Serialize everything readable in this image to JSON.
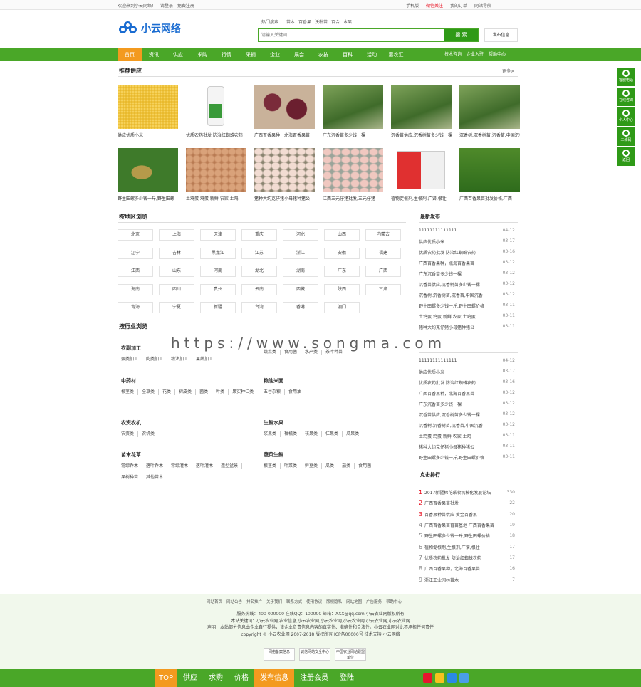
{
  "topbar": {
    "left": [
      "欢迎来到小云网络！",
      "请登录",
      "免费注册"
    ],
    "right": [
      "手机版",
      "微信关注",
      "我的订单",
      "网站导航"
    ]
  },
  "header": {
    "logo_text": "小云网络",
    "hot_label": "热门搜索：",
    "hot_words": [
      "苗木",
      "百香果",
      "沃柑苗",
      "百合",
      "水果"
    ],
    "search_placeholder": "请输入关键词",
    "search_button": "搜 索",
    "publish_button": "发布信息"
  },
  "nav": {
    "items": [
      "首页",
      "资讯",
      "供应",
      "求购",
      "行情",
      "采摘",
      "企业",
      "展会",
      "农技",
      "百科",
      "活动",
      "惠农汇"
    ],
    "right": [
      "技术咨询",
      "企业入驻",
      "帮助中心"
    ]
  },
  "supply": {
    "title": "推荐供应",
    "more": "更多>",
    "products": [
      {
        "caption": "供应优质小米",
        "kind": "millet"
      },
      {
        "caption": "优质农药批发 防治红蜘蛛农药",
        "kind": "bottle"
      },
      {
        "caption": "广西百香果种，北海百香果苗",
        "kind": "passion"
      },
      {
        "caption": "广东沉香苗多少钱一棵",
        "kind": "seedling"
      },
      {
        "caption": "沉香苗供应,沉香树苗多少钱一棵",
        "kind": "seedling"
      },
      {
        "caption": "沉香树,沉香树苗,沉香苗,中国沉香",
        "kind": "seedling"
      },
      {
        "caption": "野生田螺多少钱一斤,野生田螺",
        "kind": "snail"
      },
      {
        "caption": "土鸡蛋 鸡蛋 新鲜 农家 土鸡",
        "kind": "eggs"
      },
      {
        "caption": "猪种大约克仔猪小母猪种猪公",
        "kind": "pigs"
      },
      {
        "caption": "江西三元仔猪批发,三元仔猪",
        "kind": "piglets"
      },
      {
        "caption": "植物促根剂,生根剂,广谱,根壮",
        "kind": "box"
      },
      {
        "caption": "广西百香果苗批发价格,广西",
        "kind": "seedling2"
      }
    ]
  },
  "regions": {
    "title": "按地区浏览",
    "items": [
      "北京",
      "上海",
      "天津",
      "重庆",
      "河北",
      "山西",
      "内蒙古",
      "辽宁",
      "吉林",
      "黑龙江",
      "江苏",
      "浙江",
      "安徽",
      "福建",
      "江西",
      "山东",
      "河南",
      "湖北",
      "湖南",
      "广东",
      "广西",
      "海南",
      "四川",
      "贵州",
      "云南",
      "西藏",
      "陕西",
      "甘肃",
      "青海",
      "宁夏",
      "新疆",
      "台湾",
      "香港",
      "澳门"
    ]
  },
  "latest": {
    "title": "最新发布",
    "items": [
      {
        "t": "11111111111111",
        "d": "04-12"
      },
      {
        "t": "供应优质小米",
        "d": "03-17"
      },
      {
        "t": "优质农药批发 防治红蜘蛛农药",
        "d": "03-16"
      },
      {
        "t": "广西百香果种，北海百香果苗",
        "d": "03-12"
      },
      {
        "t": "广东沉香苗多少钱一棵",
        "d": "03-12"
      },
      {
        "t": "沉香苗供应,沉香树苗多少钱一棵",
        "d": "03-12"
      },
      {
        "t": "沉香树,沉香树苗,沉香苗,中国沉香",
        "d": "03-12"
      },
      {
        "t": "野生田螺多少钱一斤,野生田螺价格",
        "d": "03-11"
      },
      {
        "t": "土鸡蛋 鸡蛋 新鲜 农家 土鸡蛋",
        "d": "03-11"
      },
      {
        "t": "猪种大约克仔猪小母猪种猪公",
        "d": "03-11"
      }
    ]
  },
  "industry": {
    "title": "按行业浏览",
    "groups": [
      {
        "name": "农副加工",
        "tags": [
          "蛋类加工",
          "肉类加工",
          "粮油加工",
          "果蔬加工"
        ]
      },
      {
        "name": "",
        "tags": [
          "蔬菜类",
          "食用菌",
          "水产类",
          "茶叶种苗"
        ]
      },
      {
        "name": "中药材",
        "tags": [
          "根茎类",
          "全草类",
          "花类",
          "树皮类",
          "菌类",
          "叶类",
          "果实种仁类"
        ]
      },
      {
        "name": "粮油米面",
        "tags": [
          "五谷杂粮",
          "食用油"
        ]
      },
      {
        "name": "农资农机",
        "tags": [
          "农资类",
          "农机类"
        ]
      },
      {
        "name": "生鲜水果",
        "tags": [
          "浆果类",
          "柑橘类",
          "核果类",
          "仁果类",
          "瓜果类"
        ]
      },
      {
        "name": "苗木花草",
        "tags": [
          "常绿乔木",
          "落叶乔木",
          "常绿灌木",
          "落叶灌木",
          "造型盆景",
          "果树种苗",
          "其他苗木"
        ]
      },
      {
        "name": "蔬菜生鲜",
        "tags": [
          "根茎类",
          "叶菜类",
          "鲜豆类",
          "瓜类",
          "茄类",
          "食用菌"
        ]
      }
    ]
  },
  "latest2": {
    "items": [
      {
        "t": "11111111111111",
        "d": "04-12"
      },
      {
        "t": "供应优质小米",
        "d": "03-17"
      },
      {
        "t": "优质农药批发 防治红蜘蛛农药",
        "d": "03-16"
      },
      {
        "t": "广西百香果种，北海百香果苗",
        "d": "03-12"
      },
      {
        "t": "广东沉香苗多少钱一棵",
        "d": "03-12"
      },
      {
        "t": "沉香苗供应,沉香树苗多少钱一棵",
        "d": "03-12"
      },
      {
        "t": "沉香树,沉香树苗,沉香苗,中国沉香",
        "d": "03-12"
      },
      {
        "t": "土鸡蛋 鸡蛋 新鲜 农家 土鸡",
        "d": "03-11"
      },
      {
        "t": "猪种大约克仔猪小母猪种猪公",
        "d": "03-11"
      },
      {
        "t": "野生田螺多少钱一斤,野生田螺价格",
        "d": "03-11"
      }
    ]
  },
  "ranking": {
    "title": "点击排行",
    "items": [
      {
        "n": "1",
        "t": "2017新疆棉花采收机械化发展论坛",
        "c": "330"
      },
      {
        "n": "2",
        "t": "广西百香果苗批发",
        "c": "22"
      },
      {
        "n": "3",
        "t": "百香果种苗供应 黄金百香果",
        "c": "20"
      },
      {
        "n": "4",
        "t": "广西百香果苗育苗基地 广西百香果苗",
        "c": "19"
      },
      {
        "n": "5",
        "t": "野生田螺多少钱一斤,野生田螺价格",
        "c": "18"
      },
      {
        "n": "6",
        "t": "植物促根剂,生根剂,广谱,根壮",
        "c": "17"
      },
      {
        "n": "7",
        "t": "优质农药批发 防治红蜘蛛农药",
        "c": "17"
      },
      {
        "n": "8",
        "t": "广西百香果种，北海百香果苗",
        "c": "16"
      },
      {
        "n": "9",
        "t": "浙江工业园林苗木",
        "c": "7"
      }
    ]
  },
  "footer": {
    "links": [
      "网站首页",
      "网站公告",
      "排名推广",
      "关于我们",
      "联系方式",
      "使用协议",
      "版权隐私",
      "网站地图",
      "广告服务",
      "帮助中心"
    ],
    "lines": [
      "服务热线：400-000000 在线QQ：100000 邮箱：XXX@qq.com 小云农业网版权所有",
      "本站关键词：小云农业网,农业信息,小云农业网,小云农业网,小云农业网,小云农业网,小云农业网",
      "声明：本站部分信息由企业自行提供，该企业负责信息内容的真实性、准确性和合法性。小云农业网对此不承担任何责任",
      "copyright © 小云农业网 2007-2018 版权所有  ICP备00000号 技术支持:小云网络"
    ],
    "badges": [
      "网络备案信息",
      "诚信网站安全中心",
      "中国农业网站联盟单位"
    ]
  },
  "bottombar": {
    "items": [
      "TOP",
      "供应",
      "求购",
      "价格",
      "发布信息",
      "注册会员",
      "登陆"
    ]
  },
  "sidebar": {
    "items": [
      "客服电话",
      "在线咨询",
      "个人中心",
      "二维码",
      "返回"
    ]
  },
  "watermark": "https://www.songma.com"
}
